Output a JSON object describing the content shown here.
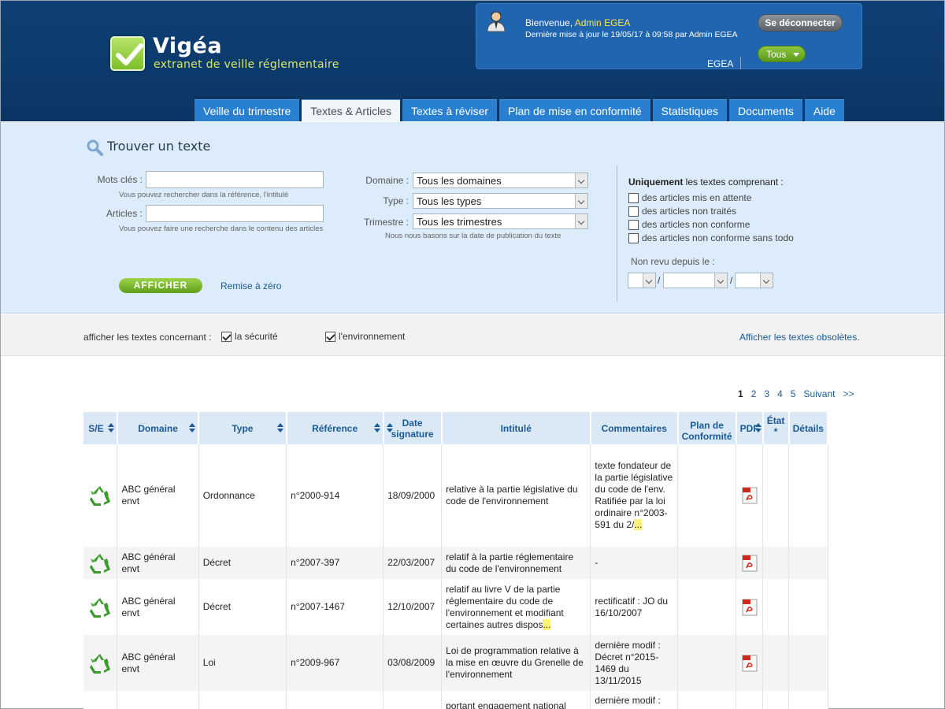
{
  "header": {
    "logo_title": "Vigéa",
    "logo_subtitle": "extranet de veille réglementaire",
    "welcome_prefix": "Bienvenue, ",
    "user_name": "Admin EGEA",
    "last_update": "Dernière mise à jour le 19/05/17 à 09:58 par Admin EGEA",
    "logout_label": "Se déconnecter",
    "company": "EGEA",
    "scope_label": "Tous"
  },
  "tabs": [
    {
      "label": "Veille du trimestre",
      "active": false
    },
    {
      "label": "Textes & Articles",
      "active": true
    },
    {
      "label": "Textes à réviser",
      "active": false
    },
    {
      "label": "Plan de mise en conformité",
      "active": false
    },
    {
      "label": "Statistiques",
      "active": false
    },
    {
      "label": "Documents",
      "active": false
    },
    {
      "label": "Aide",
      "active": false
    }
  ],
  "search": {
    "title": "Trouver un texte",
    "keywords_label": "Mots clés :",
    "keywords_value": "",
    "keywords_hint": "Vous pouvez rechercher dans la référence, l'intitulé",
    "articles_label": "Articles :",
    "articles_value": "",
    "articles_hint": "Vous pouvez faire une recherche dans le contenu des articles",
    "domain_label": "Domaine :",
    "domain_value": "Tous les domaines",
    "type_label": "Type :",
    "type_value": "Tous les types",
    "quarter_label": "Trimestre :",
    "quarter_value": "Tous les trimestres",
    "quarter_hint": "Nous nous basons sur la date de publication du texte",
    "only_bold": "Uniquement",
    "only_rest": " les textes comprenant :",
    "only_options": [
      {
        "label": "des articles mis en attente",
        "checked": false
      },
      {
        "label": "des articles non traités",
        "checked": false
      },
      {
        "label": "des articles non conforme",
        "checked": false
      },
      {
        "label": "des articles non conforme sans todo",
        "checked": false
      }
    ],
    "not_reviewed_label": "Non revu depuis le :",
    "date_day": "",
    "date_month": "",
    "date_year": "",
    "submit_label": "AFFICHER",
    "reset_label": "Remise à zéro"
  },
  "filter": {
    "label": "afficher les textes concernant :",
    "security_label": "la sécurité",
    "security_checked": true,
    "environment_label": "l'environnement",
    "environment_checked": true,
    "obsolete_link": "Afficher les textes obsolètes."
  },
  "pagination": {
    "pages": [
      "1",
      "2",
      "3",
      "4",
      "5"
    ],
    "current": "1",
    "next": "Suivant",
    "last": ">>"
  },
  "table": {
    "headers": {
      "se": "S/E",
      "domain": "Domaine",
      "type": "Type",
      "reference": "Référence",
      "date_line1": "Date",
      "date_line2": "signature",
      "title": "Intitulé",
      "comments": "Commentaires",
      "plan_line1": "Plan de",
      "plan_line2": "Conformité",
      "pdf": "PDF",
      "state_line1": "État",
      "state_line2": "*",
      "details": "Détails"
    },
    "rows": [
      {
        "domain": "ABC général envt",
        "type": "Ordonnance",
        "reference": "n°2000-914",
        "date": "18/09/2000",
        "title": "relative à la partie législative du code de l'environnement",
        "title_more": "",
        "comment": "texte fondateur de la partie législative du code de l'env. Ratifiée par la loi ordinaire n°2003-591 du 2/",
        "comment_more": "..."
      },
      {
        "domain": "ABC général envt",
        "type": "Décret",
        "reference": "n°2007-397",
        "date": "22/03/2007",
        "title": "relatif à la partie réglementaire du code de l'environnement",
        "title_more": "",
        "comment": "-",
        "comment_more": ""
      },
      {
        "domain": "ABC général envt",
        "type": "Décret",
        "reference": "n°2007-1467",
        "date": "12/10/2007",
        "title": "relatif au livre V de la partie réglementaire du code de l'environnement et modifiant certaines autres dispos",
        "title_more": "...",
        "comment": "rectificatif : JO du 16/10/2007",
        "comment_more": ""
      },
      {
        "domain": "ABC général envt",
        "type": "Loi",
        "reference": "n°2009-967",
        "date": "03/08/2009",
        "title": "Loi de programmation relative à la mise en œuvre du Grenelle de l'environnement",
        "title_more": "",
        "comment": "dernière modif : Décret n°2015-1469 du 13/11/2015",
        "comment_more": ""
      },
      {
        "domain": "",
        "type": "",
        "reference": "",
        "date": "",
        "title": "portant engagement national",
        "title_more": "",
        "comment": "dernière modif :",
        "comment_more": ""
      }
    ]
  }
}
